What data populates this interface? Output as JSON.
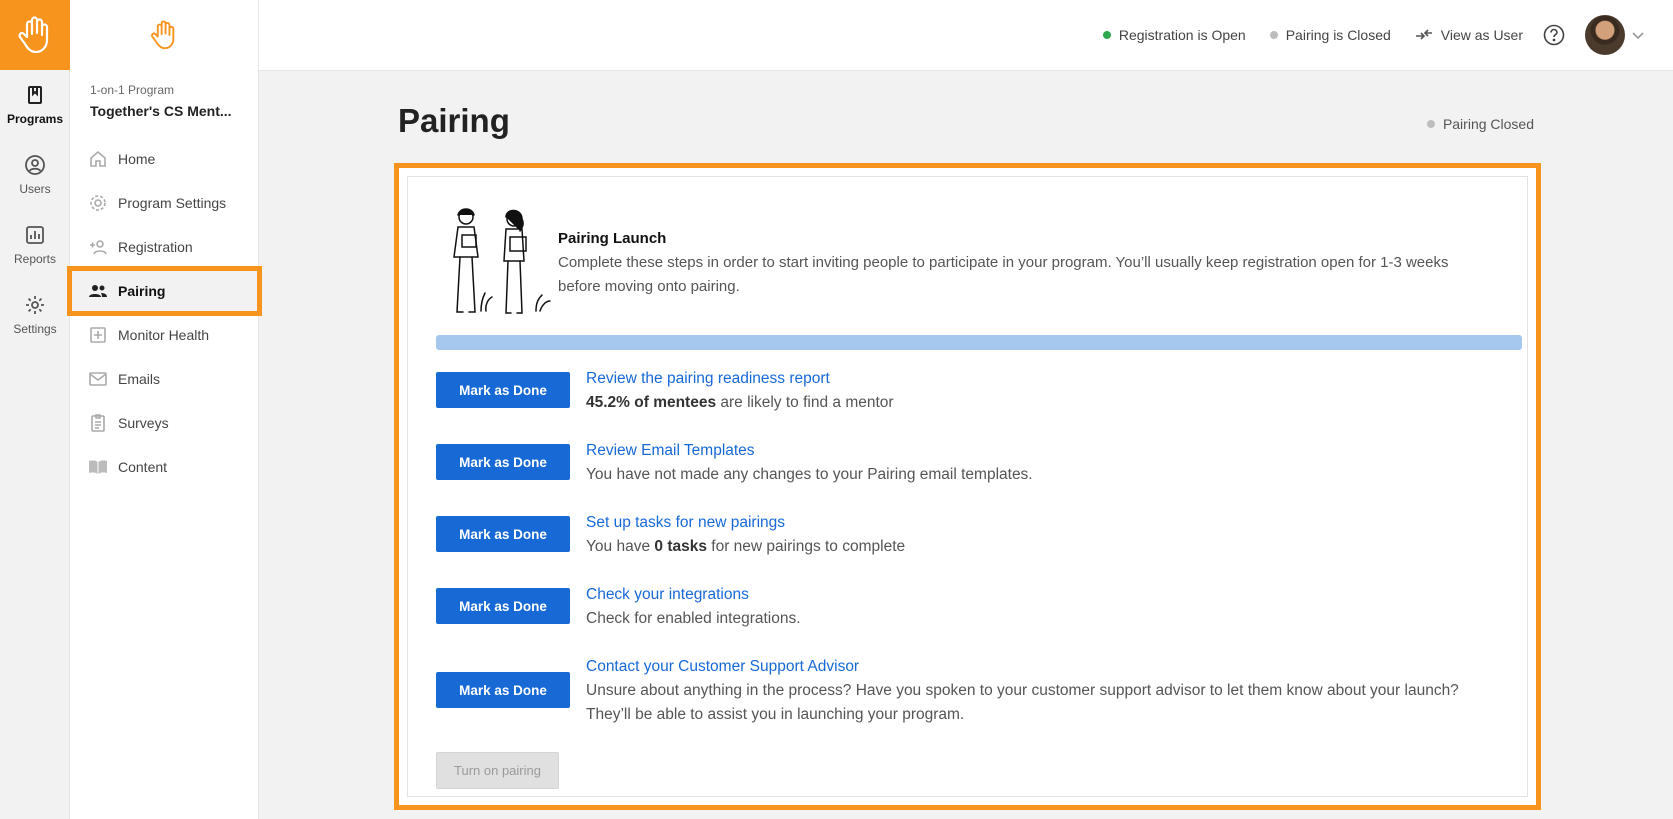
{
  "rail": {
    "items": [
      {
        "label": "Programs",
        "icon": "book-icon"
      },
      {
        "label": "Users",
        "icon": "user-circle-icon"
      },
      {
        "label": "Reports",
        "icon": "bar-chart-icon"
      },
      {
        "label": "Settings",
        "icon": "gear-icon"
      }
    ]
  },
  "sidebar": {
    "program_kicker": "1-on-1 Program",
    "program_name": "Together's CS Ment...",
    "items": [
      {
        "label": "Home",
        "icon": "home-icon"
      },
      {
        "label": "Program Settings",
        "icon": "gear-icon"
      },
      {
        "label": "Registration",
        "icon": "add-user-icon"
      },
      {
        "label": "Pairing",
        "icon": "users-icon"
      },
      {
        "label": "Monitor Health",
        "icon": "plus-square-icon"
      },
      {
        "label": "Emails",
        "icon": "mail-icon"
      },
      {
        "label": "Surveys",
        "icon": "clipboard-icon"
      },
      {
        "label": "Content",
        "icon": "open-book-icon"
      }
    ],
    "active": "Pairing"
  },
  "topbar": {
    "registration_status": "Registration is Open",
    "pairing_status": "Pairing is Closed",
    "view_as_user": "View as User"
  },
  "main": {
    "title": "Pairing",
    "status": "Pairing Closed",
    "launch": {
      "title": "Pairing Launch",
      "description": "Complete these steps in order to start inviting people to participate in your program. You’ll usually keep registration open for 1-3 weeks before moving onto pairing."
    },
    "mark_done_label": "Mark as Done",
    "steps": [
      {
        "link": "Review the pairing readiness report",
        "desc_bold": "45.2% of mentees",
        "desc_rest": " are likely to find a mentor"
      },
      {
        "link": "Review Email Templates",
        "desc_pre": "You have not made any changes to your Pairing email templates."
      },
      {
        "link": "Set up tasks for new pairings",
        "desc_pre": "You have ",
        "desc_bold": "0 tasks",
        "desc_rest": " for new pairings to complete"
      },
      {
        "link": "Check your integrations",
        "desc_pre": "Check for enabled integrations."
      },
      {
        "link": "Contact your Customer Support Advisor",
        "desc_pre": "Unsure about anything in the process? Have you spoken to your customer support advisor to let them know about your launch? They’ll be able to assist you in launching your program."
      }
    ],
    "turn_on_label": "Turn on pairing"
  },
  "colors": {
    "brand_orange": "#f7941d",
    "primary_blue": "#1769d6",
    "progress_fill": "#a6c8ef",
    "open_green": "#2fa84f",
    "closed_gray": "#bdbdbd"
  }
}
